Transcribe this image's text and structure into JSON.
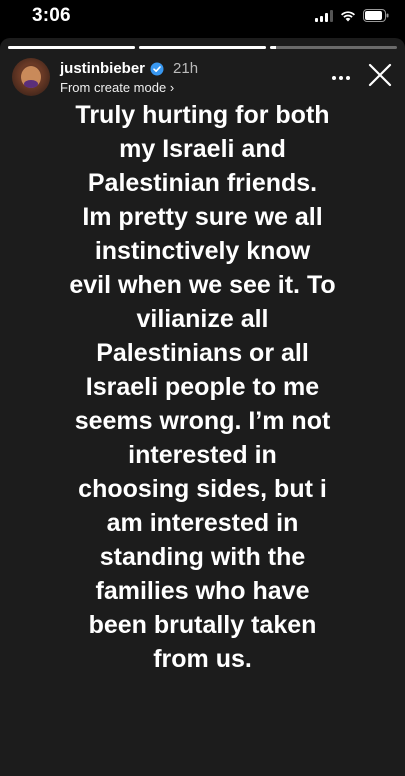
{
  "status_bar": {
    "time": "3:06",
    "icons": [
      "cellular-signal-icon",
      "wifi-icon",
      "battery-icon"
    ]
  },
  "story": {
    "progress": [
      1,
      1,
      0.05
    ],
    "username": "justinbieber",
    "time_ago": "21h",
    "subline": "From create mode ›",
    "verified_icon": "verified-badge-icon",
    "more_icon": "more-options-icon",
    "close_icon": "close-icon",
    "text_lines": [
      "Truly hurting for both",
      "my Israeli and",
      "Palestinian friends.",
      "Im pretty sure we all",
      "instinctively know",
      "evil when we see it. To",
      "vilianize all",
      "Palestinians or all",
      "Israeli people to me",
      "seems wrong. I’m not",
      "interested in",
      "choosing sides, but i",
      "am interested in",
      "standing with the",
      "families who have",
      "been brutally taken",
      "from us."
    ]
  },
  "colors": {
    "background": "#000000",
    "story_bg": "#1c1c1c",
    "text": "#ffffff",
    "verified": "#3897f0"
  }
}
